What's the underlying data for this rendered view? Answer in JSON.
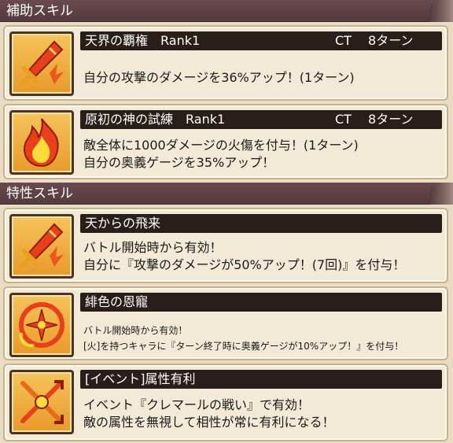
{
  "sections": {
    "support": {
      "title": "補助スキル"
    },
    "trait": {
      "title": "特性スキル"
    }
  },
  "support_skills": [
    {
      "name": "天界の覇権　Rank1",
      "ct": "CT　 8ターン",
      "icon": "flaming-sword-icon",
      "lines": [
        "自分の攻撃のダメージを36%アップ！(1ターン)"
      ]
    },
    {
      "name": "原初の神の試練　Rank1",
      "ct": "CT　 8ターン",
      "icon": "flame-icon",
      "lines": [
        "敵全体に1000ダメージの火傷を付与！(1ターン)",
        "自分の奥義ゲージを35%アップ！"
      ]
    }
  ],
  "trait_skills": [
    {
      "name": "天からの飛来",
      "icon": "flaming-sword-icon",
      "lines": [
        "バトル開始時から有効！",
        "自分に『攻撃のダメージが50%アップ！(7回)』を付与！"
      ]
    },
    {
      "name": "緋色の恩寵",
      "icon": "fire-crest-icon",
      "lines": [
        "バトル開始時から有効！",
        "[火]を持つキャラに『ターン終了時に奥義ゲージが10%アップ！』を付与！"
      ]
    },
    {
      "name": "[イベント]属性有利",
      "icon": "crossed-arrows-icon",
      "lines": [
        "イベント『クレマールの戦い』で有効！",
        "敵の属性を無視して相性が常に有利になる！"
      ]
    }
  ],
  "colors": {
    "header_bg": "#5e4246",
    "title_bar": "#2a1e1a",
    "card_bg": "#f2ead6",
    "icon_bg": "#f0b040"
  }
}
